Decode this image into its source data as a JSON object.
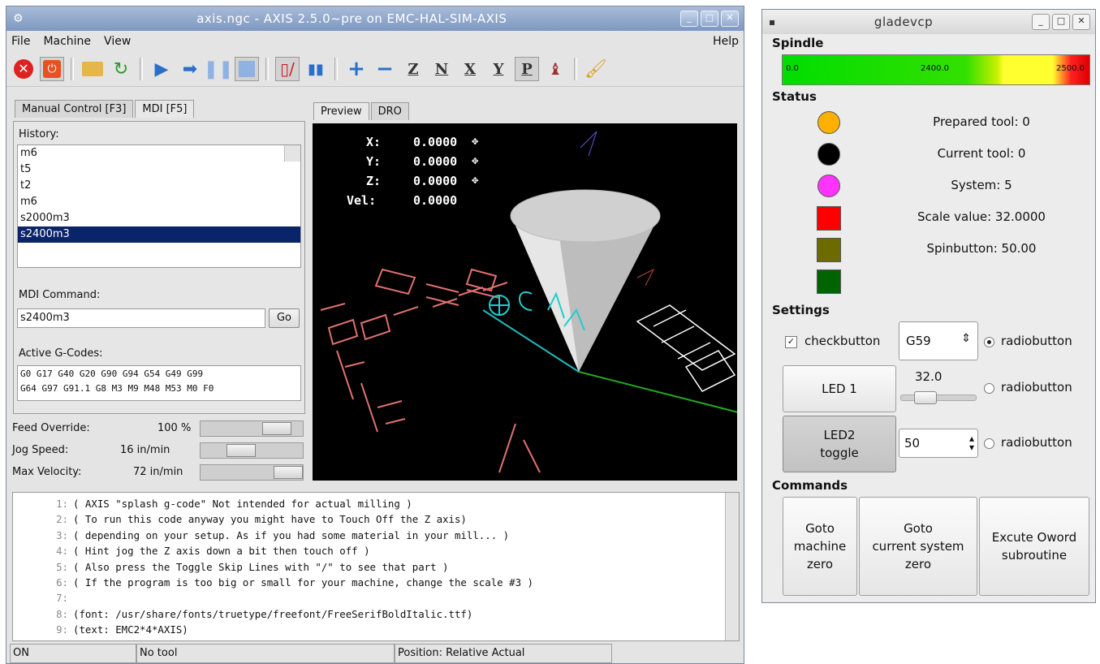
{
  "axis": {
    "title": "axis.ngc - AXIS 2.5.0~pre on EMC-HAL-SIM-AXIS",
    "menu": [
      "File",
      "Machine",
      "View"
    ],
    "help": "Help",
    "tabs_left": [
      "Manual Control [F3]",
      "MDI [F5]"
    ],
    "tabs_right": [
      "Preview",
      "DRO"
    ],
    "history_label": "History:",
    "history": [
      "m6",
      "t5",
      "t2",
      "m6",
      "s2000m3",
      "s2400m3"
    ],
    "history_selected": 5,
    "mdi_label": "MDI Command:",
    "mdi_value": "s2400m3",
    "go_label": "Go",
    "active_label": "Active G-Codes:",
    "active_line1": "G0 G17 G40 G20 G90 G94 G54 G49 G99",
    "active_line2": "G64 G97 G91.1 G8 M3 M9 M48 M53 M0 F0",
    "feed_label": "Feed Override:",
    "feed_value": "100 %",
    "jog_label": "Jog Speed:",
    "jog_value": "16 in/min",
    "maxvel_label": "Max Velocity:",
    "maxvel_value": "72 in/min",
    "dro": {
      "x_label": "X:",
      "x_value": "0.0000",
      "y_label": "Y:",
      "y_value": "0.0000",
      "z_label": "Z:",
      "z_value": "0.0000",
      "vel_label": "Vel:",
      "vel_value": "0.0000"
    },
    "code_lines": [
      {
        "n": "1:",
        "t": "( AXIS \"splash g-code\" Not intended for actual milling )"
      },
      {
        "n": "2:",
        "t": "( To run this code anyway you might have to Touch Off the Z axis)"
      },
      {
        "n": "3:",
        "t": "( depending on your setup. As if you had some material in your mill... )"
      },
      {
        "n": "4:",
        "t": "( Hint jog the Z axis down a bit then touch off )"
      },
      {
        "n": "5:",
        "t": "( Also press the Toggle Skip Lines with \"/\" to see that part )"
      },
      {
        "n": "6:",
        "t": "( If the program is too big or small for your machine, change the scale #3 )"
      },
      {
        "n": "7:",
        "t": ""
      },
      {
        "n": "8:",
        "t": "(font: /usr/share/fonts/truetype/freefont/FreeSerifBoldItalic.ttf)"
      },
      {
        "n": "9:",
        "t": "(text: EMC2*4*AXIS)"
      }
    ],
    "status_on": "ON",
    "status_tool": "No tool",
    "status_pos": "Position: Relative Actual"
  },
  "gladevcp": {
    "title": "gladevcp",
    "spindle_label": "Spindle",
    "bar_min": "0.0",
    "bar_mid": "2400.0",
    "bar_max": "2500.0",
    "status_label": "Status",
    "prepared_tool": "Prepared tool: 0",
    "current_tool": "Current tool: 0",
    "system": "System: 5",
    "scale_value": "Scale value: 32.0000",
    "spinbutton": "Spinbutton: 50.00",
    "settings_label": "Settings",
    "checkbutton": "checkbutton",
    "combo_value": "G59",
    "radio1": "radiobutton",
    "radio2": "radiobutton",
    "radio3": "radiobutton",
    "led1": "LED 1",
    "led2": "LED2\ntoggle",
    "hscale_value": "32.0",
    "spin_value": "50",
    "commands_label": "Commands",
    "cmd1": "Goto\nmachine\nzero",
    "cmd2": "Goto\ncurrent system\nzero",
    "cmd3": "Excute Oword\nsubroutine",
    "colors": {
      "led_prepared": "#ffb000",
      "led_current": "#000000",
      "led_system": "#ff33ff",
      "sw_red": "#ff0000",
      "sw_olive": "#6b6b00",
      "sw_green": "#006400"
    }
  }
}
